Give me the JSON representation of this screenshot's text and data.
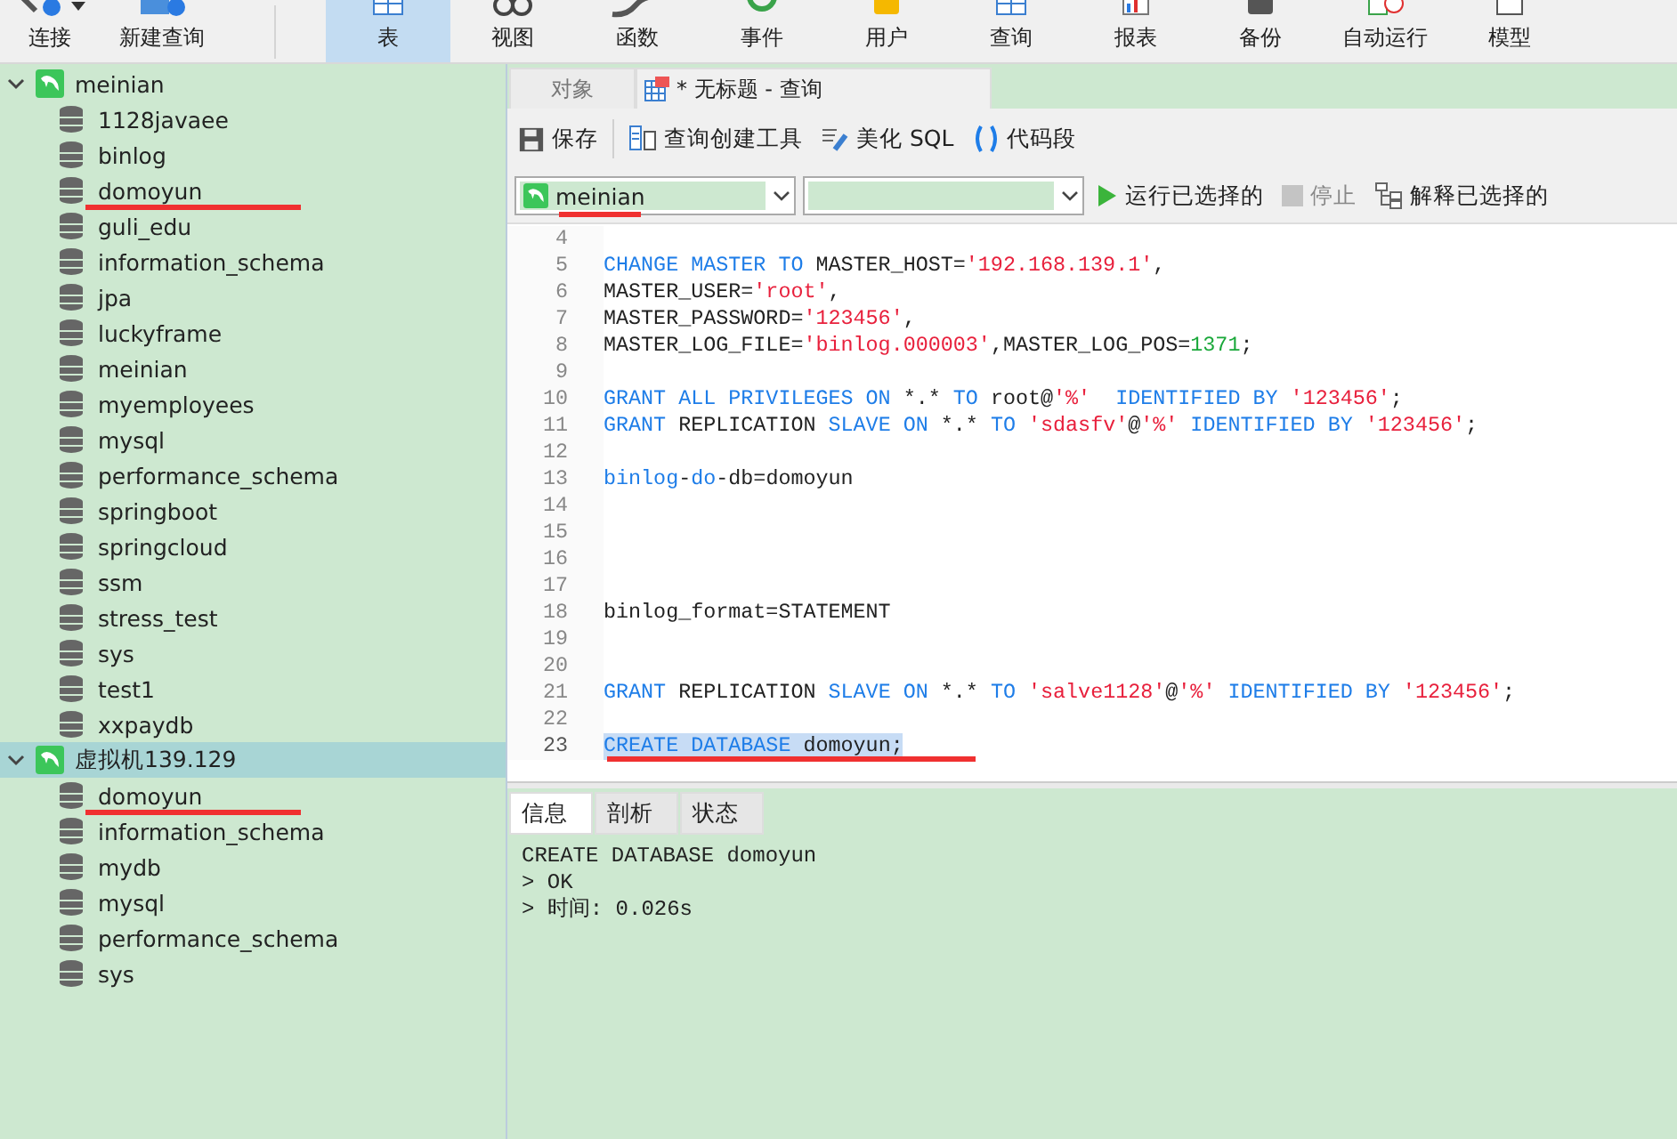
{
  "toolbar": [
    {
      "label": "连接",
      "dropdown": true,
      "selected": false
    },
    {
      "label": "新建查询",
      "dropdown": false,
      "selected": false
    },
    {
      "label": "表",
      "dropdown": false,
      "selected": true
    },
    {
      "label": "视图",
      "dropdown": false,
      "selected": false
    },
    {
      "label": "函数",
      "dropdown": false,
      "selected": false
    },
    {
      "label": "事件",
      "dropdown": false,
      "selected": false
    },
    {
      "label": "用户",
      "dropdown": false,
      "selected": false
    },
    {
      "label": "查询",
      "dropdown": false,
      "selected": false
    },
    {
      "label": "报表",
      "dropdown": false,
      "selected": false
    },
    {
      "label": "备份",
      "dropdown": false,
      "selected": false
    },
    {
      "label": "自动运行",
      "dropdown": false,
      "selected": false
    },
    {
      "label": "模型",
      "dropdown": false,
      "selected": false
    }
  ],
  "tree": [
    {
      "label": "meinian",
      "expanded": true,
      "selected": false,
      "children": [
        {
          "label": "1128javaee",
          "underlined": false
        },
        {
          "label": "binlog",
          "underlined": false
        },
        {
          "label": "domoyun",
          "underlined": true
        },
        {
          "label": "guli_edu",
          "underlined": false
        },
        {
          "label": "information_schema",
          "underlined": false
        },
        {
          "label": "jpa",
          "underlined": false
        },
        {
          "label": "luckyframe",
          "underlined": false
        },
        {
          "label": "meinian",
          "underlined": false
        },
        {
          "label": "myemployees",
          "underlined": false
        },
        {
          "label": "mysql",
          "underlined": false
        },
        {
          "label": "performance_schema",
          "underlined": false
        },
        {
          "label": "springboot",
          "underlined": false
        },
        {
          "label": "springcloud",
          "underlined": false
        },
        {
          "label": "ssm",
          "underlined": false
        },
        {
          "label": "stress_test",
          "underlined": false
        },
        {
          "label": "sys",
          "underlined": false
        },
        {
          "label": "test1",
          "underlined": false
        },
        {
          "label": "xxpaydb",
          "underlined": false
        }
      ]
    },
    {
      "label": "虚拟机139.129",
      "expanded": true,
      "selected": true,
      "children": [
        {
          "label": "domoyun",
          "underlined": true
        },
        {
          "label": "information_schema",
          "underlined": false
        },
        {
          "label": "mydb",
          "underlined": false
        },
        {
          "label": "mysql",
          "underlined": false
        },
        {
          "label": "performance_schema",
          "underlined": false
        },
        {
          "label": "sys",
          "underlined": false
        }
      ]
    }
  ],
  "tabs": [
    {
      "label": "对象",
      "selected": false
    },
    {
      "label": "* 无标题 - 查询",
      "selected": true
    }
  ],
  "query_toolbar": [
    {
      "label": "保存"
    },
    {
      "label": "查询创建工具"
    },
    {
      "label": "美化 SQL"
    },
    {
      "label": "代码段"
    }
  ],
  "connection_select": {
    "value": "meinian",
    "underlined": true
  },
  "actions": [
    {
      "label": "运行已选择的",
      "disabled": false
    },
    {
      "label": "停止",
      "disabled": true
    },
    {
      "label": "解释已选择的",
      "disabled": false
    }
  ],
  "code_lines": [
    {
      "number": "4",
      "selected": false,
      "underlined": false
    },
    {
      "number": "5",
      "selected": false,
      "underlined": false,
      "tokens": [
        {
          "text": "CHANGE MASTER TO",
          "kind": "kw"
        },
        {
          "text": " MASTER_HOST=",
          "kind": "plain"
        },
        {
          "text": "'192.168.139.1'",
          "kind": "str"
        },
        {
          "text": ",",
          "kind": "plain"
        }
      ]
    },
    {
      "number": "6",
      "selected": false,
      "underlined": false,
      "tokens": [
        {
          "text": "MASTER_USER=",
          "kind": "plain"
        },
        {
          "text": "'root'",
          "kind": "str"
        },
        {
          "text": ",",
          "kind": "plain"
        }
      ]
    },
    {
      "number": "7",
      "selected": false,
      "underlined": false,
      "tokens": [
        {
          "text": "MASTER_PASSWORD=",
          "kind": "plain"
        },
        {
          "text": "'123456'",
          "kind": "str"
        },
        {
          "text": ",",
          "kind": "plain"
        }
      ]
    },
    {
      "number": "8",
      "selected": false,
      "underlined": false,
      "tokens": [
        {
          "text": "MASTER_LOG_FILE=",
          "kind": "plain"
        },
        {
          "text": "'binlog.000003'",
          "kind": "str"
        },
        {
          "text": ",MASTER_LOG_POS=",
          "kind": "plain"
        },
        {
          "text": "1371",
          "kind": "num"
        },
        {
          "text": ";",
          "kind": "plain"
        }
      ]
    },
    {
      "number": "9",
      "selected": false,
      "underlined": false
    },
    {
      "number": "10",
      "selected": false,
      "underlined": false,
      "tokens": [
        {
          "text": "GRANT ALL PRIVILEGES ON",
          "kind": "kw"
        },
        {
          "text": " *.* ",
          "kind": "plain"
        },
        {
          "text": "TO",
          "kind": "kw"
        },
        {
          "text": " root@",
          "kind": "plain"
        },
        {
          "text": "'%'",
          "kind": "str"
        },
        {
          "text": "  IDENTIFIED BY",
          "kind": "kw"
        },
        {
          "text": " '123456'",
          "kind": "str"
        },
        {
          "text": ";",
          "kind": "plain"
        }
      ]
    },
    {
      "number": "11",
      "selected": false,
      "underlined": false,
      "tokens": [
        {
          "text": "GRANT",
          "kind": "kw"
        },
        {
          "text": " REPLICATION ",
          "kind": "plain"
        },
        {
          "text": "SLAVE ON",
          "kind": "kw"
        },
        {
          "text": " *.* ",
          "kind": "plain"
        },
        {
          "text": "TO",
          "kind": "kw"
        },
        {
          "text": " 'sdasfv'",
          "kind": "str"
        },
        {
          "text": "@",
          "kind": "plain"
        },
        {
          "text": "'%'",
          "kind": "str"
        },
        {
          "text": " IDENTIFIED BY",
          "kind": "kw"
        },
        {
          "text": " '123456'",
          "kind": "str"
        },
        {
          "text": ";",
          "kind": "plain"
        }
      ]
    },
    {
      "number": "12",
      "selected": false,
      "underlined": false
    },
    {
      "number": "13",
      "selected": false,
      "underlined": false,
      "tokens": [
        {
          "text": "binlog",
          "kind": "kw"
        },
        {
          "text": "-",
          "kind": "plain"
        },
        {
          "text": "do",
          "kind": "kw"
        },
        {
          "text": "-db=domoyun",
          "kind": "plain"
        }
      ]
    },
    {
      "number": "14",
      "selected": false,
      "underlined": false
    },
    {
      "number": "15",
      "selected": false,
      "underlined": false
    },
    {
      "number": "16",
      "selected": false,
      "underlined": false
    },
    {
      "number": "17",
      "selected": false,
      "underlined": false
    },
    {
      "number": "18",
      "selected": false,
      "underlined": false,
      "tokens": [
        {
          "text": "binlog_format=STATEMENT",
          "kind": "plain"
        }
      ]
    },
    {
      "number": "19",
      "selected": false,
      "underlined": false
    },
    {
      "number": "20",
      "selected": false,
      "underlined": false
    },
    {
      "number": "21",
      "selected": false,
      "underlined": false,
      "tokens": [
        {
          "text": "GRANT",
          "kind": "kw"
        },
        {
          "text": " REPLICATION ",
          "kind": "plain"
        },
        {
          "text": "SLAVE ON",
          "kind": "kw"
        },
        {
          "text": " *.* ",
          "kind": "plain"
        },
        {
          "text": "TO",
          "kind": "kw"
        },
        {
          "text": " 'salve1128'",
          "kind": "str"
        },
        {
          "text": "@",
          "kind": "plain"
        },
        {
          "text": "'%'",
          "kind": "str"
        },
        {
          "text": " IDENTIFIED BY",
          "kind": "kw"
        },
        {
          "text": " '123456'",
          "kind": "str"
        },
        {
          "text": ";",
          "kind": "plain"
        }
      ]
    },
    {
      "number": "22",
      "selected": false,
      "underlined": false
    },
    {
      "number": "23",
      "selected": true,
      "underlined": true,
      "tokens": [
        {
          "text": "CREATE DATABASE",
          "kind": "kw"
        },
        {
          "text": " domoyun;",
          "kind": "plain"
        }
      ]
    }
  ],
  "result_tabs": [
    {
      "label": "信息",
      "selected": true
    },
    {
      "label": "剖析",
      "selected": false
    },
    {
      "label": "状态",
      "selected": false
    }
  ],
  "result_lines": [
    "CREATE DATABASE domoyun",
    "> OK",
    "> 时间: 0.026s"
  ]
}
